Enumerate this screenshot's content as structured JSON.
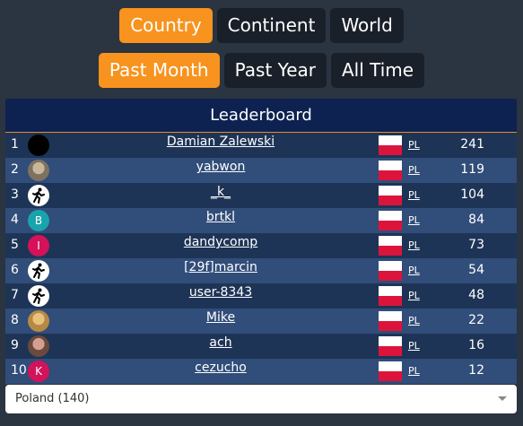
{
  "scope_tabs": [
    "Country",
    "Continent",
    "World"
  ],
  "active_scope": "Country",
  "period_tabs": [
    "Past Month",
    "Past Year",
    "All Time"
  ],
  "active_period": "Past Month",
  "leaderboard": {
    "title": "Leaderboard",
    "rows": [
      {
        "rank": "1",
        "name": "Damian Zalewski",
        "avatar": "black",
        "country": "PL",
        "score": "241"
      },
      {
        "rank": "2",
        "name": "yabwon",
        "avatar": "photo1",
        "country": "PL",
        "score": "119"
      },
      {
        "rank": "3",
        "name": "_k_",
        "avatar": "runner",
        "country": "PL",
        "score": "104"
      },
      {
        "rank": "4",
        "name": "brtkl",
        "avatar": "teal",
        "avatar_letter": "B",
        "country": "PL",
        "score": "84"
      },
      {
        "rank": "5",
        "name": "dandycomp",
        "avatar": "pink",
        "avatar_letter": "I",
        "country": "PL",
        "score": "73"
      },
      {
        "rank": "6",
        "name": "[29f]marcin",
        "avatar": "runner",
        "country": "PL",
        "score": "54"
      },
      {
        "rank": "7",
        "name": "user-8343",
        "avatar": "runner",
        "country": "PL",
        "score": "48"
      },
      {
        "rank": "8",
        "name": "Mike",
        "avatar": "photo2",
        "country": "PL",
        "score": "22"
      },
      {
        "rank": "9",
        "name": "ach",
        "avatar": "photo3",
        "country": "PL",
        "score": "16"
      },
      {
        "rank": "10",
        "name": "cezucho",
        "avatar": "pink",
        "avatar_letter": "K",
        "country": "PL",
        "score": "12"
      }
    ]
  },
  "country_select": {
    "value": "Poland (140)"
  },
  "colors": {
    "background": "#2b3441",
    "accent": "#f7931e",
    "button": "#1a2029",
    "header": "#0d2250",
    "row": "#1e3456",
    "row_alt": "#314d79",
    "flag_red": "#dc143c"
  }
}
